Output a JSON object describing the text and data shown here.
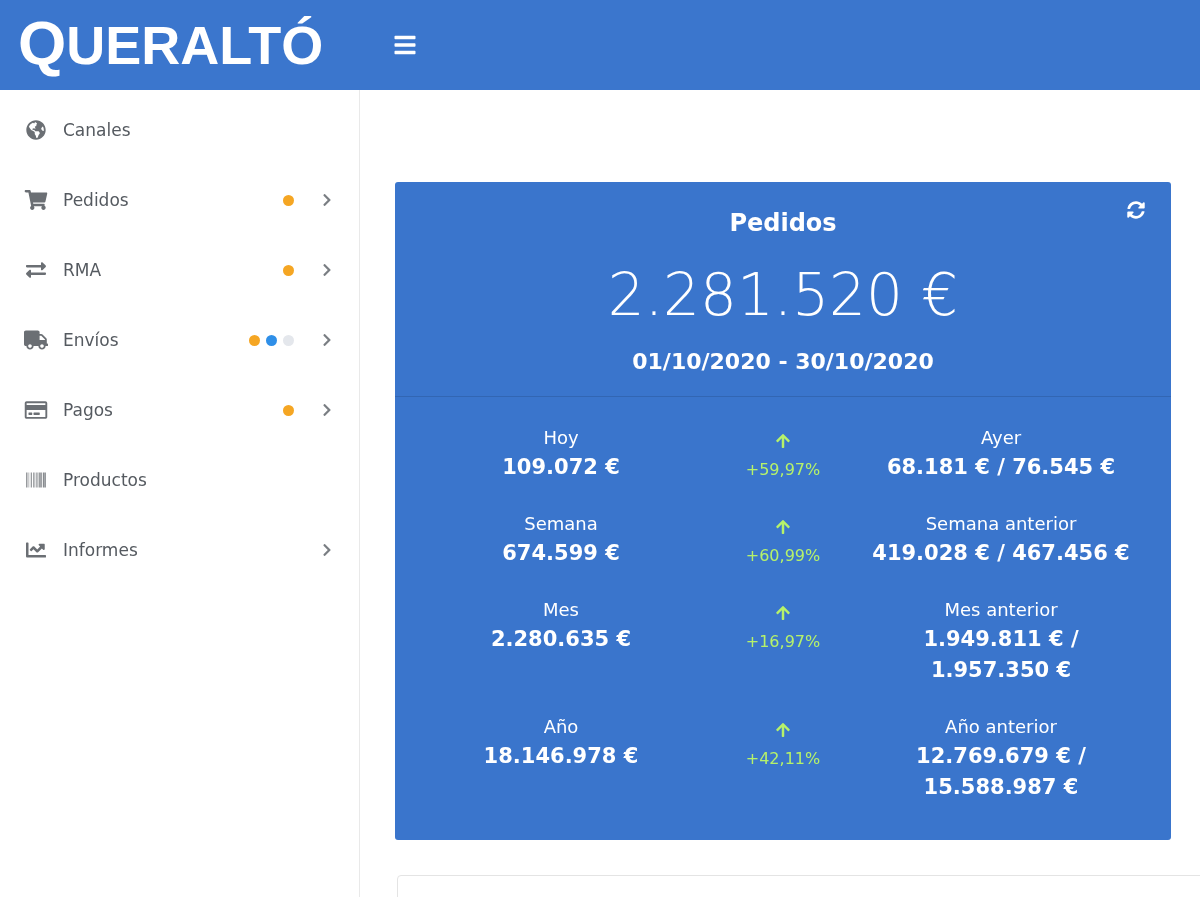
{
  "header": {
    "logo": "QUERALTÓ"
  },
  "sidebar": {
    "items": [
      {
        "label": "Canales",
        "kind": "link"
      },
      {
        "label": "Pedidos",
        "kind": "submenu",
        "dots": [
          {
            "color": "#f5a623"
          }
        ]
      },
      {
        "label": "RMA",
        "kind": "submenu",
        "dots": [
          {
            "color": "#f5a623"
          }
        ]
      },
      {
        "label": "Envíos",
        "kind": "submenu",
        "dots": [
          {
            "color": "#f5a623"
          },
          {
            "color": "#2f8fe8"
          },
          {
            "color": "#e4e7ec"
          }
        ]
      },
      {
        "label": "Pagos",
        "kind": "submenu",
        "dots": [
          {
            "color": "#f5a623"
          }
        ]
      },
      {
        "label": "Productos",
        "kind": "link"
      },
      {
        "label": "Informes",
        "kind": "submenu"
      }
    ]
  },
  "card": {
    "title": "Pedidos",
    "total": "2.281.520 €",
    "period": "01/10/2020 - 30/10/2020",
    "stats": [
      {
        "label": "Hoy",
        "value": "109.072 €",
        "rising": true,
        "change": "+59,97%",
        "previous_label": "Ayer",
        "previous_value": "68.181 € / 76.545 €"
      },
      {
        "label": "Semana",
        "value": "674.599 €",
        "rising": true,
        "change": "+60,99%",
        "previous_label": "Semana anterior",
        "previous_value": "419.028 € / 467.456 €"
      },
      {
        "label": "Mes",
        "value": "2.280.635 €",
        "rising": true,
        "change": "+16,97%",
        "previous_label": "Mes anterior",
        "previous_value": "1.949.811 € / 1.957.350 €"
      },
      {
        "label": "Año",
        "value": "18.146.978 €",
        "rising": true,
        "change": "+42,11%",
        "previous_label": "Año anterior",
        "previous_value": "12.769.679 € / 15.588.987 €"
      }
    ]
  }
}
